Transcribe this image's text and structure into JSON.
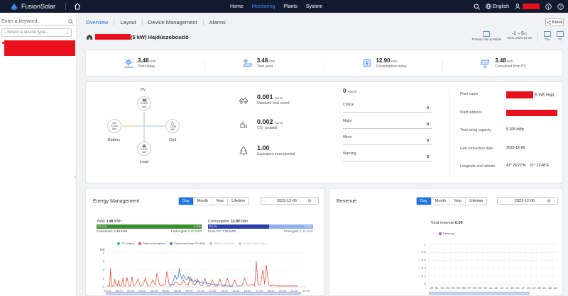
{
  "topbar": {
    "app_name": "FusionSolar",
    "nav": [
      "Home",
      "Monitoring",
      "Plants",
      "System"
    ],
    "active_nav": "Monitoring",
    "language": "English",
    "colors": {
      "bg": "#111a2e",
      "accent": "#3a8ff7"
    }
  },
  "sidebar": {
    "search_placeholder": "Enter a keyword",
    "device_type_placeholder": "--Select a device type--"
  },
  "tabs": [
    "Overview",
    "Layout",
    "Device Management",
    "Alarms"
  ],
  "active_tab": "Overview",
  "kiosk_label": "Kiosk",
  "plant": {
    "title_suffix": "(5 kW) Hajdúszoboszló"
  },
  "weather": {
    "polarity": "Polarity rate possible",
    "temp": "-1 ~ 5",
    "temp_unit": "°C",
    "date": "Wed. 2023-12-06",
    "day2": "Thu",
    "day3": "Fri"
  },
  "kpis": [
    {
      "value": "3.48",
      "unit": "kWh",
      "label": "Yield today",
      "icon": "sun-yield-icon"
    },
    {
      "value": "3.48",
      "unit": "kWh",
      "label": "Total yield",
      "icon": "total-yield-icon"
    },
    {
      "value": "12.90",
      "unit": "kWh",
      "label": "Consumption today",
      "icon": "consumption-icon"
    },
    {
      "value": "3.48",
      "unit": "kWh",
      "label": "Consumed from PV",
      "icon": "pv-consumed-icon"
    }
  ],
  "flow": {
    "pv": {
      "label": "PV",
      "value": "0.000",
      "unit": "kW"
    },
    "battery": {
      "label": "Battery",
      "soc": "2%",
      "value": "0.400",
      "unit": "kW"
    },
    "grid": {
      "label": "Grid",
      "value": "1.238",
      "unit": "kW"
    },
    "load": {
      "label": "Load",
      "value": "0.120",
      "unit": "kW"
    }
  },
  "env": [
    {
      "value": "0.001",
      "unit": "(tons)",
      "label": "Standard coal saved",
      "icon": "coal-icon"
    },
    {
      "value": "0.002",
      "unit": "(tons)",
      "label": "CO₂ avoided",
      "icon": "co2-icon"
    },
    {
      "value": "1.00",
      "unit": "",
      "label": "Equivalent trees planted",
      "icon": "tree-icon"
    }
  ],
  "alarms": {
    "count": "0",
    "label": "Alarm",
    "rows": [
      {
        "name": "Critical",
        "count": "0"
      },
      {
        "name": "Major",
        "count": "0"
      },
      {
        "name": "Minor",
        "count": "0"
      },
      {
        "name": "Warning",
        "count": "0"
      }
    ]
  },
  "plant_info": [
    {
      "key": "Plant name",
      "value": "(5 kW) Hajd..."
    },
    {
      "key": "Plant address",
      "value": ""
    },
    {
      "key": "Total string capacity",
      "value": "5.265 kWp"
    },
    {
      "key": "Grid connection date",
      "value": "2023-12-06"
    },
    {
      "key": "Longitude and latitude",
      "value": "47° 26'22\"N    21° 22'48\"E"
    }
  ],
  "energy": {
    "title": "Energy Management",
    "periods": [
      "Day",
      "Month",
      "Year",
      "Lifetime"
    ],
    "active_period": "Day",
    "date": "2023-12-06",
    "yield": {
      "head": "Yield:",
      "value": "3.48",
      "unit": "kWh",
      "pct_consumed": "100.00%",
      "pct_fed": "0.00%",
      "consumed_label": "Consumed:",
      "consumed_value": "3.48 kWh",
      "fed_label": "Fed to grid:",
      "fed_value": "0.00 kWh"
    },
    "consumption": {
      "head": "Consumption:",
      "value": "12.90",
      "unit": "kWh",
      "pct_pv": "58.13%",
      "pct_grid": "41.87%",
      "pv_label": "From PV:",
      "pv_value": "7.55 kWh",
      "grid_label": "From grid:",
      "grid_value": "5.35 kWh"
    },
    "legend": [
      {
        "name": "PV output",
        "color": "#26c6a6"
      },
      {
        "name": "Total consumption",
        "color": "#e5533d"
      },
      {
        "name": "Consumed from PV (kW)",
        "color": "#3b82e6"
      },
      {
        "name": "Battery (charge)",
        "color": "#c0c4cc"
      },
      {
        "name": "Battery (discharge)",
        "color": "#c0c4cc"
      }
    ]
  },
  "revenue": {
    "title": "Revenue",
    "periods": [
      "Day",
      "Month",
      "Year",
      "Lifetime"
    ],
    "active_period": "Day",
    "date": "2023-12-06",
    "total_label": "Total revenue",
    "total_value": "0.00",
    "legend": "Revenue",
    "legend_color": "#c04ad8"
  },
  "chart_data": [
    {
      "type": "line",
      "ylabel": "kW",
      "ylim": [
        0,
        4
      ],
      "yticks": [
        "0",
        "1",
        "2",
        "3",
        "4"
      ],
      "x_ticks": [
        "00:00",
        "01:20",
        "02:40",
        "04:00",
        "05:20",
        "06:40",
        "08:00",
        "09:20",
        "10:40",
        "12:00",
        "13:20",
        "14:40",
        "16:00",
        "17:20",
        "18:40",
        "20:00",
        "21:20",
        "22:40"
      ],
      "series": [
        {
          "name": "Total consumption",
          "color": "#e5533d",
          "x": [
            0,
            0.3,
            0.4,
            0.5,
            0.8,
            0.9,
            1.1,
            1.2,
            1.4,
            1.5,
            1.7,
            1.9,
            2.0,
            2.2,
            2.4,
            2.6,
            2.8,
            3.0,
            3.2,
            3.4,
            3.7,
            4.0,
            4.3,
            4.6,
            4.9,
            5.2,
            5.5,
            5.8,
            6.0,
            6.3,
            6.5,
            6.8,
            7.0,
            7.2,
            7.5,
            7.8,
            8.0,
            8.3,
            8.6,
            8.9,
            9.2,
            9.5,
            9.8,
            10.0,
            10.3,
            10.6,
            10.9,
            11.2,
            11.5,
            11.8,
            12.1,
            12.4,
            12.7,
            13.0,
            13.3,
            13.6,
            13.9,
            14.2,
            14.5,
            14.8,
            15.1,
            15.4,
            15.7,
            16.0,
            16.3,
            16.6,
            16.9,
            17.2,
            17.5,
            17.8,
            18.0,
            18.2,
            18.5,
            18.8,
            19.0,
            19.2,
            19.5,
            19.8,
            20.2,
            20.6,
            21.0,
            21.5,
            22.0,
            22.5,
            23.0
          ],
          "y": [
            0.1,
            0.1,
            2.2,
            0.1,
            0.1,
            0.9,
            0.1,
            0.1,
            0.8,
            0.1,
            0.1,
            1.0,
            0.1,
            0.1,
            1.1,
            0.1,
            0.1,
            1.2,
            0.1,
            0.2,
            0.9,
            0.1,
            0.2,
            1.0,
            0.1,
            0.2,
            0.8,
            0.2,
            1.6,
            0.3,
            0.1,
            0.2,
            0.3,
            1.8,
            0.2,
            0.3,
            0.2,
            0.6,
            0.3,
            0.2,
            0.8,
            0.3,
            0.2,
            1.2,
            0.4,
            0.2,
            0.9,
            0.2,
            0.1,
            1.0,
            0.1,
            0.1,
            0.8,
            0.1,
            0.1,
            0.9,
            0.1,
            0.1,
            1.0,
            0.1,
            0.1,
            0.8,
            0.1,
            0.1,
            0.2,
            1.0,
            0.2,
            0.2,
            0.3,
            0.1,
            3.0,
            0.3,
            0.2,
            2.0,
            0.3,
            2.6,
            0.2,
            0.1,
            0.2,
            0.1,
            0.1,
            0.1,
            0.1,
            0.1,
            0.1
          ]
        },
        {
          "name": "Consumed from PV (kW)",
          "color": "#3b82e6",
          "x": [
            7.6,
            7.8,
            8.0,
            8.2,
            8.4,
            8.6,
            8.7,
            8.8,
            9.0,
            9.2,
            9.4,
            9.6,
            9.8,
            10.0,
            10.2,
            10.4,
            10.6,
            10.8,
            11.0,
            11.2,
            11.4,
            11.6,
            11.8,
            12.0,
            12.3,
            12.6,
            12.9,
            13.2,
            13.5,
            13.8,
            14.1,
            14.4,
            14.7,
            15.0,
            15.2
          ],
          "y": [
            0,
            0.3,
            0.8,
            1.4,
            0.9,
            1.2,
            2.2,
            1.6,
            0.9,
            1.4,
            1.0,
            0.8,
            1.2,
            0.7,
            0.9,
            0.6,
            0.8,
            0.5,
            0.7,
            0.5,
            0.6,
            0.4,
            0.5,
            0.4,
            0.4,
            0.3,
            0.3,
            0.3,
            0.2,
            0.2,
            0.2,
            0.1,
            0.1,
            0.05,
            0
          ]
        }
      ]
    },
    {
      "type": "bar",
      "ylim": [
        0,
        1
      ],
      "yticks": [
        "0",
        "0.2",
        "0.4",
        "0.6",
        "0.8",
        "1"
      ],
      "categories": [
        "00",
        "01",
        "02",
        "03",
        "04",
        "05",
        "06",
        "07",
        "08",
        "09",
        "10",
        "11",
        "12",
        "13",
        "14",
        "15",
        "16",
        "17",
        "18",
        "19",
        "20",
        "21",
        "22",
        "23"
      ],
      "series": [
        {
          "name": "Revenue",
          "values": [
            0,
            0,
            0,
            0,
            0,
            0,
            0,
            0,
            0,
            0,
            0,
            0,
            0,
            0,
            0,
            0,
            0,
            0,
            0,
            0,
            0,
            0,
            0,
            0
          ]
        }
      ]
    }
  ]
}
